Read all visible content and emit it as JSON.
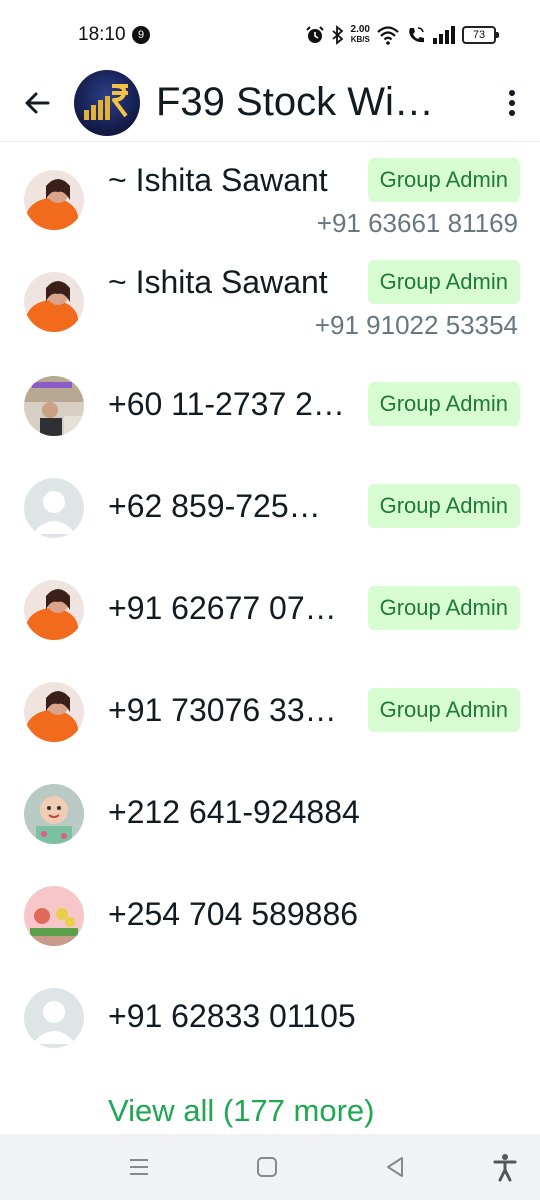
{
  "status_bar": {
    "time": "18:10",
    "notification_count": "9",
    "speed_value": "2.00",
    "speed_unit": "KB/S",
    "battery": "73"
  },
  "header": {
    "title": "F39 Stock Wi…",
    "back_icon": "arrow-left-icon",
    "menu_icon": "more-vertical-icon"
  },
  "participants": [
    {
      "name": "~ Ishita Sawant",
      "badge": "Group Admin",
      "phone": "+91 63661 81169",
      "avatar": "photo-woman-orange"
    },
    {
      "name": "~ Ishita Sawant",
      "badge": "Group Admin",
      "phone": "+91 91022 53354",
      "avatar": "photo-woman-orange"
    },
    {
      "name": "+60 11-2737 2…",
      "badge": "Group Admin",
      "avatar": "photo-man-room"
    },
    {
      "name": "+62 859-725…",
      "badge": "Group Admin",
      "avatar": "default-person-icon"
    },
    {
      "name": "+91 62677 07…",
      "badge": "Group Admin",
      "avatar": "photo-woman-orange"
    },
    {
      "name": "+91 73076 33…",
      "badge": "Group Admin",
      "avatar": "photo-woman-orange"
    },
    {
      "name": "+212 641-924884",
      "avatar": "photo-baby"
    },
    {
      "name": "+254 704 589886",
      "avatar": "photo-flowers"
    },
    {
      "name": "+91 62833 01105",
      "avatar": "default-person-icon"
    }
  ],
  "view_all": "View all (177 more)",
  "colors": {
    "badge_bg": "#d9fdd3",
    "badge_text": "#1e7a3a",
    "link_green": "#1da851"
  }
}
